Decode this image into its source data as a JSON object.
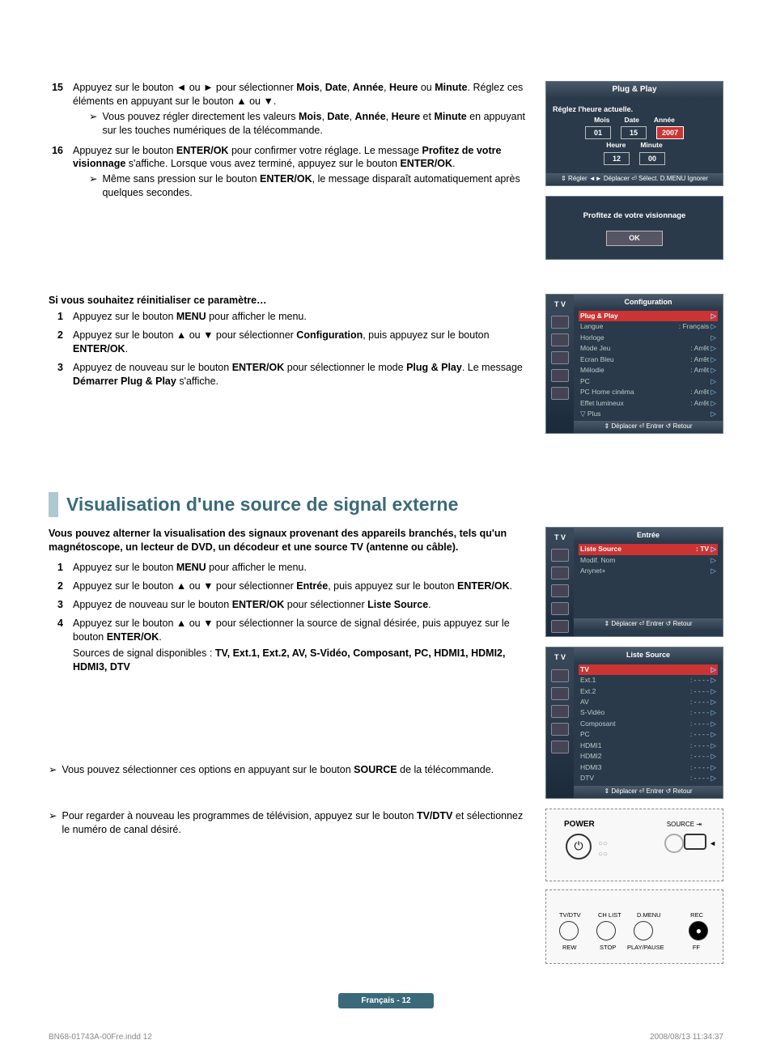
{
  "steps_a": {
    "s15": {
      "num": "15",
      "body_a": "Appuyez sur le bouton ◄ ou ► pour sélectionner ",
      "b1": "Mois",
      "sep1": ", ",
      "b2": "Date",
      "sep2": ", ",
      "b3": "Année",
      "sep3": ", ",
      "b4": "Heure",
      "sep4": " ou ",
      "b5": "Minute",
      "tail": ". Réglez ces éléments en appuyant sur le bouton ▲ ou ▼."
    },
    "s15_note": {
      "a": "Vous pouvez régler directement les valeurs ",
      "b1": "Mois",
      "sep1": ", ",
      "b2": "Date",
      "sep2": ", ",
      "b3": "Année",
      "sep3": ", ",
      "b4": "Heure",
      "sep4": " et ",
      "b5": "Minute",
      "tail": " en appuyant sur les touches numériques de la télécommande."
    },
    "s16": {
      "num": "16",
      "a": "Appuyez sur le bouton ",
      "b1": "ENTER/OK",
      "mid": " pour confirmer votre réglage. Le message ",
      "b2": "Profitez de votre visionnage",
      "mid2": " s'affiche. Lorsque vous avez terminé, appuyez sur le bouton ",
      "b3": "ENTER/OK",
      "tail": "."
    },
    "s16_note": {
      "a": "Même sans pression sur le bouton ",
      "b1": "ENTER/OK",
      "tail": ", le message disparaît automatiquement après quelques secondes."
    }
  },
  "reset": {
    "heading": "Si vous souhaitez réinitialiser ce paramètre…",
    "s1": {
      "num": "1",
      "a": "Appuyez sur le bouton ",
      "b1": "MENU",
      "tail": " pour afficher le menu."
    },
    "s2": {
      "num": "2",
      "a": "Appuyez sur le bouton ▲ ou ▼ pour sélectionner ",
      "b1": "Configuration",
      "mid": ", puis appuyez sur le bouton ",
      "b2": "ENTER/OK",
      "tail": "."
    },
    "s3": {
      "num": "3",
      "a": "Appuyez de nouveau sur le bouton ",
      "b1": "ENTER/OK",
      "mid": " pour sélectionner le mode ",
      "b2": "Plug & Play",
      "mid2": ". Le message ",
      "b3": "Démarrer Plug & Play",
      "tail": " s'affiche."
    }
  },
  "osd_pp": {
    "title": "Plug & Play",
    "subtitle": "Réglez l'heure actuelle.",
    "labels": {
      "mois": "Mois",
      "date": "Date",
      "annee": "Année",
      "heure": "Heure",
      "minute": "Minute"
    },
    "values": {
      "mois": "01",
      "date": "15",
      "annee": "2007",
      "heure": "12",
      "minute": "00"
    },
    "foot": "⇕ Régler  ◄► Déplacer  ⏎ Sélect.  D.MENU Ignorer"
  },
  "osd_done": {
    "msg": "Profitez de votre visionnage",
    "ok": "OK"
  },
  "osd_config": {
    "tv": "T V",
    "title": "Configuration",
    "rows": [
      {
        "l": "Plug & Play",
        "v": "",
        "sel": true
      },
      {
        "l": "Langue",
        "v": ": Français"
      },
      {
        "l": "Horloge",
        "v": ""
      },
      {
        "l": "Mode Jeu",
        "v": ": Arrêt"
      },
      {
        "l": "Ecran Bleu",
        "v": ": Arrêt"
      },
      {
        "l": "Mélodie",
        "v": ": Arrêt"
      },
      {
        "l": "PC",
        "v": ""
      },
      {
        "l": "PC Home cinéma",
        "v": ": Arrêt"
      },
      {
        "l": "Effet lumineux",
        "v": ": Arrêt"
      },
      {
        "l": "▽ Plus",
        "v": ""
      }
    ],
    "foot": "⇕ Déplacer  ⏎ Entrer   ↺ Retour"
  },
  "section2": {
    "title": "Visualisation d'une source de signal externe",
    "intro": "Vous pouvez alterner la visualisation des signaux provenant des appareils branchés, tels qu'un magnétoscope, un lecteur de DVD, un décodeur et une source TV (antenne ou câble).",
    "s1": {
      "num": "1",
      "a": "Appuyez sur le bouton ",
      "b1": "MENU",
      "tail": " pour afficher le menu."
    },
    "s2": {
      "num": "2",
      "a": "Appuyez sur le bouton ▲ ou ▼ pour sélectionner ",
      "b1": "Entrée",
      "mid": ", puis appuyez sur le bouton ",
      "b2": "ENTER/OK",
      "tail": "."
    },
    "s3": {
      "num": "3",
      "a": "Appuyez de nouveau sur le bouton ",
      "b1": "ENTER/OK",
      "mid": " pour sélectionner ",
      "b2": "Liste Source",
      "tail": "."
    },
    "s4": {
      "num": "4",
      "a": "Appuyez sur le bouton ▲ ou ▼ pour sélectionner la source de signal désirée, puis appuyez sur le bouton ",
      "b1": "ENTER/OK",
      "tail": "."
    },
    "s4_extra": {
      "a": "Sources de signal disponibles : ",
      "list": "TV, Ext.1, Ext.2, AV, S-Vidéo, Composant, PC, HDMI1, HDMI2, HDMI3, DTV"
    },
    "note1": {
      "a": "Vous pouvez sélectionner ces options en appuyant sur le bouton ",
      "b1": "SOURCE",
      "tail": " de la télécommande."
    },
    "note2": {
      "a": "Pour regarder à nouveau les programmes de télévision, appuyez sur le bouton ",
      "b1": "TV/DTV",
      "tail": " et sélectionnez le numéro de canal désiré."
    }
  },
  "osd_entree": {
    "tv": "T V",
    "title": "Entrée",
    "rows": [
      {
        "l": "Liste Source",
        "v": ": TV",
        "sel": true
      },
      {
        "l": "Modif. Nom",
        "v": ""
      },
      {
        "l": "Anynet+",
        "v": ""
      }
    ],
    "foot": "⇕ Déplacer  ⏎ Entrer   ↺ Retour"
  },
  "osd_liste": {
    "tv": "T V",
    "title": "Liste Source",
    "rows": [
      {
        "l": "TV",
        "v": "",
        "sel": true
      },
      {
        "l": "Ext.1",
        "v": ": - - - -"
      },
      {
        "l": "Ext.2",
        "v": ": - - - -"
      },
      {
        "l": "AV",
        "v": ": - - - -"
      },
      {
        "l": "S-Vidéo",
        "v": ": - - - -"
      },
      {
        "l": "Composant",
        "v": ": - - - -"
      },
      {
        "l": "PC",
        "v": ": - - - -"
      },
      {
        "l": "HDMI1",
        "v": ": - - - -"
      },
      {
        "l": "HDMI2",
        "v": ": - - - -"
      },
      {
        "l": "HDMI3",
        "v": ": - - - -"
      },
      {
        "l": "DTV",
        "v": ": - - - -"
      }
    ],
    "foot": "⇕ Déplacer  ⏎ Entrer   ↺ Retour"
  },
  "remote": {
    "power": "POWER",
    "source": "SOURCE",
    "tvdtv": "TV/DTV",
    "chlist": "CH LIST",
    "dmenu": "D.MENU",
    "rec": "REC",
    "rew": "REW",
    "stop": "STOP",
    "playpause": "PLAY/PAUSE",
    "ff": "FF"
  },
  "pagenum": "Français - 12",
  "footer": {
    "file": "BN68-01743A-00Fre.indd   12",
    "date": "2008/08/13   11:34:37"
  }
}
